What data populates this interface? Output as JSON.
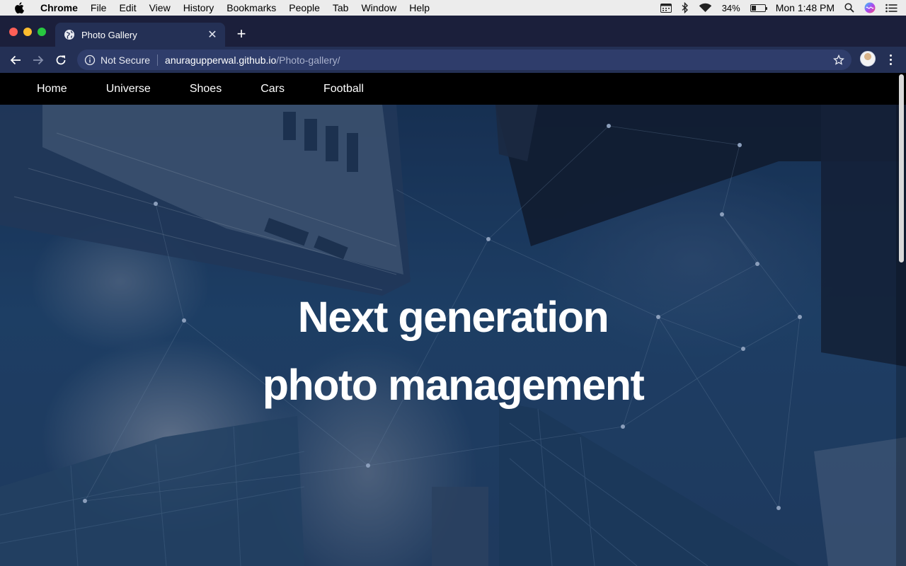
{
  "menubar": {
    "app_name": "Chrome",
    "items": [
      "File",
      "Edit",
      "View",
      "History",
      "Bookmarks",
      "People",
      "Tab",
      "Window",
      "Help"
    ],
    "battery_percent": "34%",
    "battery_level": 0.34,
    "clock": "Mon 1:48 PM"
  },
  "browser": {
    "tab_title": "Photo Gallery",
    "security_label": "Not Secure",
    "url_host": "anuragupperwal.github.io",
    "url_path": "/Photo-gallery/"
  },
  "site": {
    "nav": [
      "Home",
      "Universe",
      "Shoes",
      "Cars",
      "Football"
    ],
    "headline_line1": "Next generation",
    "headline_line2": "photo management"
  },
  "colors": {
    "tab_strip": "#1b1f3b",
    "toolbar": "#243055",
    "omnibox": "#2f3d6b",
    "site_nav": "#000000",
    "hero_overlay": "#1d3a5e"
  }
}
